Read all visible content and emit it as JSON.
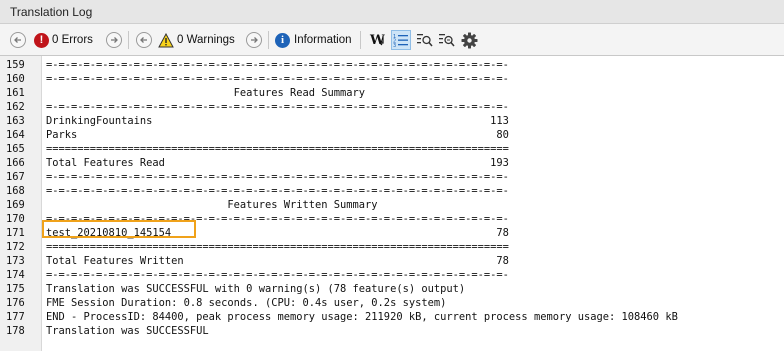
{
  "window": {
    "title": "Translation Log"
  },
  "toolbar": {
    "errors_label": "0 Errors",
    "warnings_label": "0 Warnings",
    "information_label": "Information"
  },
  "log_lines": [
    {
      "num": "159",
      "text": "=-=-=-=-=-=-=-=-=-=-=-=-=-=-=-=-=-=-=-=-=-=-=-=-=-=-=-=-=-=-=-=-=-=-=-=-=-"
    },
    {
      "num": "160",
      "text": "=-=-=-=-=-=-=-=-=-=-=-=-=-=-=-=-=-=-=-=-=-=-=-=-=-=-=-=-=-=-=-=-=-=-=-=-=-"
    },
    {
      "num": "161",
      "text": "                              Features Read Summary"
    },
    {
      "num": "162",
      "text": "=-=-=-=-=-=-=-=-=-=-=-=-=-=-=-=-=-=-=-=-=-=-=-=-=-=-=-=-=-=-=-=-=-=-=-=-=-"
    },
    {
      "num": "163",
      "text": "DrinkingFountains                                                      113"
    },
    {
      "num": "164",
      "text": "Parks                                                                   80"
    },
    {
      "num": "165",
      "text": "=========================================================================="
    },
    {
      "num": "166",
      "text": "Total Features Read                                                    193"
    },
    {
      "num": "167",
      "text": "=-=-=-=-=-=-=-=-=-=-=-=-=-=-=-=-=-=-=-=-=-=-=-=-=-=-=-=-=-=-=-=-=-=-=-=-=-"
    },
    {
      "num": "168",
      "text": "=-=-=-=-=-=-=-=-=-=-=-=-=-=-=-=-=-=-=-=-=-=-=-=-=-=-=-=-=-=-=-=-=-=-=-=-=-"
    },
    {
      "num": "169",
      "text": "                             Features Written Summary"
    },
    {
      "num": "170",
      "text": "=-=-=-=-=-=-=-=-=-=-=-=-=-=-=-=-=-=-=-=-=-=-=-=-=-=-=-=-=-=-=-=-=-=-=-=-=-"
    },
    {
      "num": "171",
      "text": "test_20210810_145154                                                    78"
    },
    {
      "num": "172",
      "text": "=========================================================================="
    },
    {
      "num": "173",
      "text": "Total Features Written                                                  78"
    },
    {
      "num": "174",
      "text": "=-=-=-=-=-=-=-=-=-=-=-=-=-=-=-=-=-=-=-=-=-=-=-=-=-=-=-=-=-=-=-=-=-=-=-=-=-"
    },
    {
      "num": "175",
      "text": "Translation was SUCCESSFUL with 0 warning(s) (78 feature(s) output)"
    },
    {
      "num": "176",
      "text": "FME Session Duration: 0.8 seconds. (CPU: 0.4s user, 0.2s system)"
    },
    {
      "num": "177",
      "text": "END - ProcessID: 84400, peak process memory usage: 211920 kB, current process memory usage: 108460 kB"
    },
    {
      "num": "178",
      "text": "Translation was SUCCESSFUL"
    }
  ]
}
